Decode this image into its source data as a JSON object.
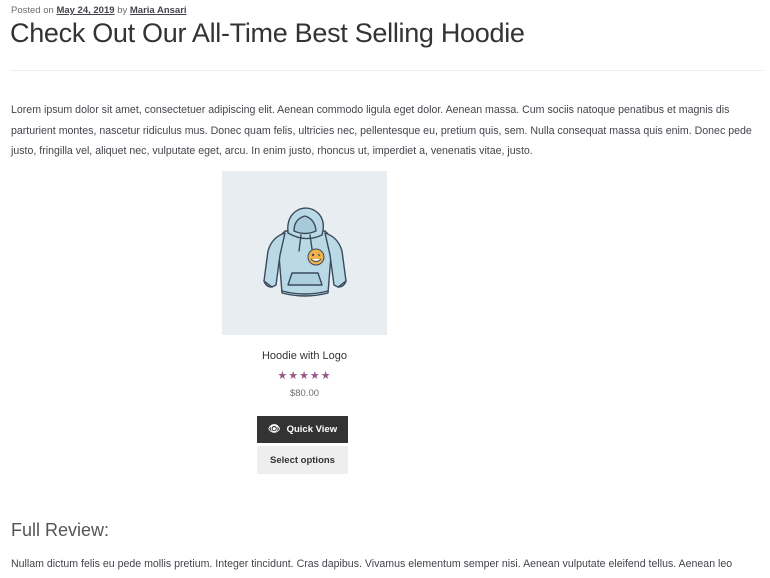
{
  "post_meta": {
    "posted_on_label": "Posted on",
    "date": "May 24, 2019",
    "by_label": "by",
    "author": "Maria Ansari"
  },
  "post_title": "Check Out Our All-Time Best Selling Hoodie",
  "intro_paragraph": "Lorem ipsum dolor sit amet, consectetuer adipiscing elit. Aenean commodo ligula eget dolor. Aenean massa. Cum sociis natoque penatibus et magnis dis parturient montes, nascetur ridiculus mus. Donec quam felis, ultricies nec, pellentesque eu, pretium quis, sem. Nulla consequat massa quis enim. Donec pede justo, fringilla vel, aliquet nec, vulputate eget, arcu. In enim justo, rhoncus ut, imperdiet a, venenatis vitae, justo.",
  "product": {
    "name": "Hoodie with Logo",
    "rating": 5,
    "rating_max": 5,
    "stars_text": "★★★★★",
    "price": "$80.00",
    "quick_view_icon": "eye-icon",
    "quick_view_glyph": "👁",
    "quick_view_label": "Quick View",
    "select_options_label": "Select options",
    "image_icon": "hoodie-icon"
  },
  "review_heading": "Full Review:",
  "review_paragraph": "Nullam dictum felis eu pede mollis pretium. Integer tincidunt. Cras dapibus. Vivamus elementum semper nisi. Aenean vulputate eleifend tellus. Aenean leo",
  "colors": {
    "accent": "#96588a",
    "button_dark": "#333333",
    "button_light": "#eeeeee",
    "image_bg": "#e8edf1"
  }
}
